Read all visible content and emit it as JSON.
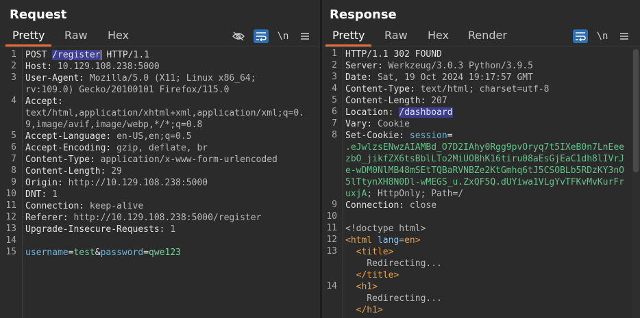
{
  "request": {
    "title": "Request",
    "tabs": [
      "Pretty",
      "Raw",
      "Hex"
    ],
    "tools": {
      "hide_icon": "eye-slash-icon",
      "wrap_icon": "wrap-lines-icon",
      "newline_label": "\\n",
      "menu_icon": "hamburger-menu-icon"
    },
    "lines": [
      {
        "n": "1",
        "parts": [
          {
            "t": "POST ",
            "c": "m"
          },
          {
            "t": "/register",
            "c": "hl"
          },
          {
            "t": " HTTP/1.1",
            "c": "m"
          }
        ]
      },
      {
        "n": "2",
        "parts": [
          {
            "t": "Host: ",
            "c": "k"
          },
          {
            "t": "10.129.108.238:5000",
            "c": "v"
          }
        ]
      },
      {
        "n": "3",
        "parts": [
          {
            "t": "User-Agent: ",
            "c": "k"
          },
          {
            "t": "Mozilla/5.0 (X11; Linux x86_64;",
            "c": "v"
          }
        ]
      },
      {
        "n": "",
        "parts": [
          {
            "t": "rv:109.0) Gecko/20100101 Firefox/115.0",
            "c": "v"
          }
        ]
      },
      {
        "n": "4",
        "parts": [
          {
            "t": "Accept:",
            "c": "k"
          }
        ]
      },
      {
        "n": "",
        "parts": [
          {
            "t": "text/html,application/xhtml+xml,application/xml;q=0.",
            "c": "v"
          }
        ]
      },
      {
        "n": "",
        "parts": [
          {
            "t": "9,image/avif,image/webp,*/*;q=0.8",
            "c": "v"
          }
        ]
      },
      {
        "n": "5",
        "parts": [
          {
            "t": "Accept-Language: ",
            "c": "k"
          },
          {
            "t": "en-US,en;q=0.5",
            "c": "v"
          }
        ]
      },
      {
        "n": "6",
        "parts": [
          {
            "t": "Accept-Encoding: ",
            "c": "k"
          },
          {
            "t": "gzip, deflate, br",
            "c": "v"
          }
        ]
      },
      {
        "n": "7",
        "parts": [
          {
            "t": "Content-Type: ",
            "c": "k"
          },
          {
            "t": "application/x-www-form-urlencoded",
            "c": "v"
          }
        ]
      },
      {
        "n": "8",
        "parts": [
          {
            "t": "Content-Length: ",
            "c": "k"
          },
          {
            "t": "29",
            "c": "v"
          }
        ]
      },
      {
        "n": "9",
        "parts": [
          {
            "t": "Origin: ",
            "c": "k"
          },
          {
            "t": "http://10.129.108.238:5000",
            "c": "v"
          }
        ]
      },
      {
        "n": "10",
        "parts": [
          {
            "t": "DNT: ",
            "c": "k"
          },
          {
            "t": "1",
            "c": "v"
          }
        ]
      },
      {
        "n": "11",
        "parts": [
          {
            "t": "Connection: ",
            "c": "k"
          },
          {
            "t": "keep-alive",
            "c": "v"
          }
        ]
      },
      {
        "n": "12",
        "parts": [
          {
            "t": "Referer: ",
            "c": "k"
          },
          {
            "t": "http://10.129.108.238:5000/register",
            "c": "v"
          }
        ]
      },
      {
        "n": "13",
        "parts": [
          {
            "t": "Upgrade-Insecure-Requests: ",
            "c": "k"
          },
          {
            "t": "1",
            "c": "v"
          }
        ]
      },
      {
        "n": "14",
        "parts": []
      },
      {
        "n": "15",
        "parts": [
          {
            "t": "username",
            "c": "pk"
          },
          {
            "t": "=",
            "c": "k"
          },
          {
            "t": "test",
            "c": "pv"
          },
          {
            "t": "&",
            "c": "k"
          },
          {
            "t": "password",
            "c": "pk"
          },
          {
            "t": "=",
            "c": "k"
          },
          {
            "t": "qwe123",
            "c": "pv"
          }
        ]
      }
    ]
  },
  "response": {
    "title": "Response",
    "tabs": [
      "Pretty",
      "Raw",
      "Hex",
      "Render"
    ],
    "tools": {
      "wrap_icon": "wrap-lines-icon",
      "newline_label": "\\n",
      "menu_icon": "hamburger-menu-icon"
    },
    "lines": [
      {
        "n": "1",
        "parts": [
          {
            "t": "HTTP/1.1 302 FOUND",
            "c": "m"
          }
        ]
      },
      {
        "n": "2",
        "parts": [
          {
            "t": "Server: ",
            "c": "k"
          },
          {
            "t": "Werkzeug/3.0.3 Python/3.9.5",
            "c": "v"
          }
        ]
      },
      {
        "n": "3",
        "parts": [
          {
            "t": "Date: ",
            "c": "k"
          },
          {
            "t": "Sat, 19 Oct 2024 19:17:57 GMT",
            "c": "v"
          }
        ]
      },
      {
        "n": "4",
        "parts": [
          {
            "t": "Content-Type: ",
            "c": "k"
          },
          {
            "t": "text/html; charset=utf-8",
            "c": "v"
          }
        ]
      },
      {
        "n": "5",
        "parts": [
          {
            "t": "Content-Length: ",
            "c": "k"
          },
          {
            "t": "207",
            "c": "v"
          }
        ]
      },
      {
        "n": "6",
        "parts": [
          {
            "t": "Location: ",
            "c": "k"
          },
          {
            "t": "/dashboard",
            "c": "hl"
          }
        ]
      },
      {
        "n": "7",
        "parts": [
          {
            "t": "Vary: ",
            "c": "k"
          },
          {
            "t": "Cookie",
            "c": "v"
          }
        ]
      },
      {
        "n": "8",
        "parts": [
          {
            "t": "Set-Cookie: ",
            "c": "k"
          },
          {
            "t": "session",
            "c": "pk"
          },
          {
            "t": "=",
            "c": "k"
          }
        ]
      },
      {
        "n": "",
        "parts": [
          {
            "t": ".eJwlzsENwzAIAMBd_O7D2IAhy0Rgg9pvOryq7t5IXeB0n7LnEee",
            "c": "g"
          }
        ]
      },
      {
        "n": "",
        "parts": [
          {
            "t": "zbO_jikfZX6tsBblLTo2MiUOBhK16tiru08aEsGjEaC1dh8lIVrJ",
            "c": "g"
          }
        ]
      },
      {
        "n": "",
        "parts": [
          {
            "t": "e-wDM0NlMB48mSEtTQBaRVNBZe2KtGmhq6tJ5CSOBLb5RDzKY3nO",
            "c": "g"
          }
        ]
      },
      {
        "n": "",
        "parts": [
          {
            "t": "5lTtynXH8N0Dl-wMEGS_u.ZxQF5Q.dUYiwa1VLgYvTFKvMvKurFr",
            "c": "g"
          }
        ]
      },
      {
        "n": "",
        "parts": [
          {
            "t": "uxjA",
            "c": "g"
          },
          {
            "t": "; HttpOnly; Path=/",
            "c": "v"
          }
        ]
      },
      {
        "n": "9",
        "parts": [
          {
            "t": "Connection: ",
            "c": "k"
          },
          {
            "t": "close",
            "c": "v"
          }
        ]
      },
      {
        "n": "10",
        "parts": []
      },
      {
        "n": "11",
        "parts": [
          {
            "t": "<!doctype html>",
            "c": "v"
          }
        ]
      },
      {
        "n": "12",
        "parts": [
          {
            "t": "<html ",
            "c": "tg"
          },
          {
            "t": "lang",
            "c": "an"
          },
          {
            "t": "=",
            "c": "v"
          },
          {
            "t": "en",
            "c": "av"
          },
          {
            "t": ">",
            "c": "tg"
          }
        ]
      },
      {
        "n": "13",
        "parts": [
          {
            "t": "  <title>",
            "c": "tg"
          }
        ]
      },
      {
        "n": "",
        "parts": [
          {
            "t": "    Redirecting...",
            "c": "v"
          }
        ]
      },
      {
        "n": "",
        "parts": [
          {
            "t": "  </title>",
            "c": "tg"
          }
        ]
      },
      {
        "n": "14",
        "parts": [
          {
            "t": "  <h1>",
            "c": "tg"
          }
        ]
      },
      {
        "n": "",
        "parts": [
          {
            "t": "    Redirecting...",
            "c": "v"
          }
        ]
      },
      {
        "n": "",
        "parts": [
          {
            "t": "  </h1>",
            "c": "tg"
          }
        ]
      }
    ]
  },
  "colors": {
    "accent_tab": "#e8743b",
    "active_tool": "#2f6fb0",
    "highlight": "#3e3e8e"
  }
}
